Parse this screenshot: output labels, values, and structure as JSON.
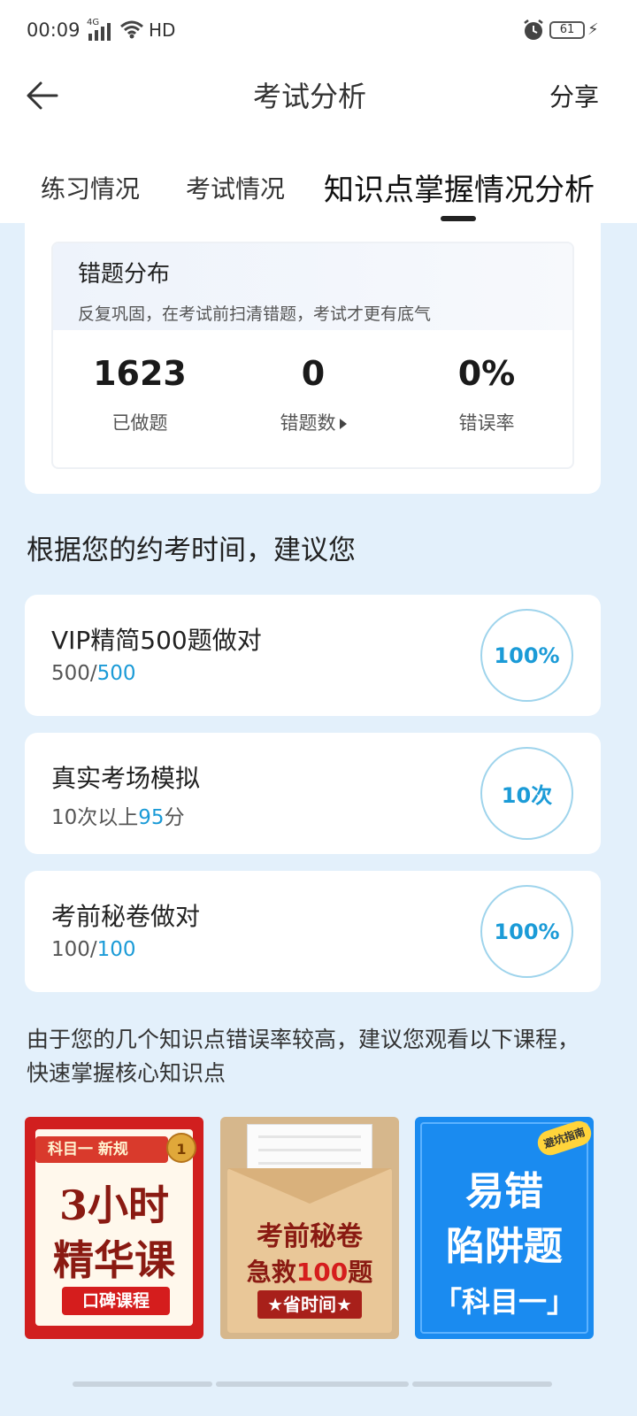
{
  "status": {
    "time": "00:09",
    "network": "4G",
    "hd": "HD",
    "battery": "61"
  },
  "header": {
    "title": "考试分析",
    "share": "分享"
  },
  "tabs": [
    {
      "label": "练习情况"
    },
    {
      "label": "考试情况"
    },
    {
      "label": "知识点掌握情况分析",
      "active": true
    }
  ],
  "errors": {
    "title": "错题分布",
    "subtitle": "反复巩固，在考试前扫清错题，考试才更有底气",
    "stats": [
      {
        "value": "1623",
        "label": "已做题"
      },
      {
        "value": "0",
        "label": "错题数"
      },
      {
        "value": "0%",
        "label": "错误率"
      }
    ]
  },
  "suggest": {
    "title": "根据您的约考时间，建议您",
    "tasks": [
      {
        "name": "VIP精简500题做对",
        "prog_a": "500/",
        "prog_b": "500",
        "prog_c": "",
        "ring": "100%"
      },
      {
        "name": "真实考场模拟",
        "prog_a": "10次以上",
        "prog_b": "95",
        "prog_c": "分",
        "ring": "10次"
      },
      {
        "name": "考前秘卷做对",
        "prog_a": "100/",
        "prog_b": "100",
        "prog_c": "",
        "ring": "100%"
      }
    ]
  },
  "courses": {
    "intro": "由于您的几个知识点错误率较高，建议您观看以下课程，快速掌握核心知识点",
    "c1": {
      "ribbon": "科目一 新规",
      "badge": "1",
      "line1": "3小时",
      "line2": "精华课",
      "tag": "口碑课程"
    },
    "c2": {
      "line1": "考前秘卷",
      "line2a": "急救",
      "line2b": "100",
      "line2c": "题",
      "tag": "★省时间★"
    },
    "c3": {
      "corner": "避坑指南",
      "line1": "易错",
      "line2": "陷阱题",
      "sub": "「科目一」"
    }
  },
  "colors": {
    "accent": "#1b9bd7",
    "page_bg": "#e3f0fb"
  }
}
